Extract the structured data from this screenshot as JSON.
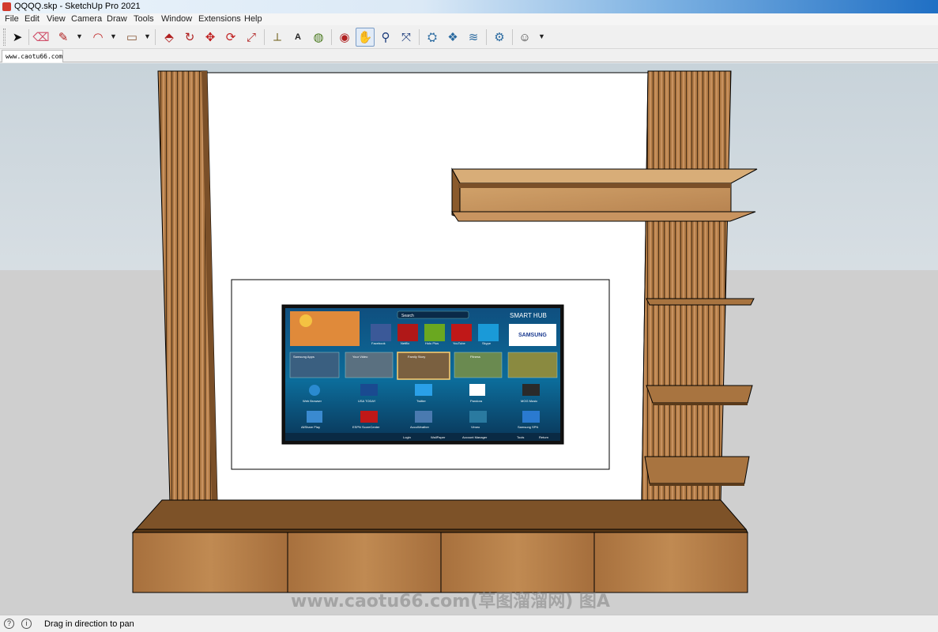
{
  "window": {
    "title": "QQQQ.skp - SketchUp Pro 2021"
  },
  "menu": [
    "File",
    "Edit",
    "View",
    "Camera",
    "Draw",
    "Tools",
    "Window",
    "Extensions",
    "Help"
  ],
  "toolbar": {
    "tools": [
      {
        "name": "select-tool",
        "glyph": "➤"
      },
      {
        "name": "eraser-tool",
        "glyph": "⌫"
      },
      {
        "name": "line-tool",
        "glyph": "✎"
      },
      {
        "name": "arc-tool",
        "glyph": "◠"
      },
      {
        "name": "rectangle-tool",
        "glyph": "▭"
      },
      {
        "name": "push-pull-tool",
        "glyph": "⬘"
      },
      {
        "name": "follow-me-tool",
        "glyph": "↻"
      },
      {
        "name": "move-tool",
        "glyph": "✥"
      },
      {
        "name": "rotate-tool",
        "glyph": "⟳"
      },
      {
        "name": "scale-tool",
        "glyph": "⤢"
      },
      {
        "name": "tape-measure-tool",
        "glyph": "⟂"
      },
      {
        "name": "text-tool",
        "glyph": "A"
      },
      {
        "name": "paint-bucket-tool",
        "glyph": "◍"
      },
      {
        "name": "orbit-tool",
        "glyph": "◉"
      },
      {
        "name": "pan-tool",
        "glyph": "✋"
      },
      {
        "name": "zoom-tool",
        "glyph": "⚲"
      },
      {
        "name": "zoom-extents-tool",
        "glyph": "⤧"
      },
      {
        "name": "warehouse-tool",
        "glyph": "⛭"
      },
      {
        "name": "extension-warehouse-tool",
        "glyph": "❖"
      },
      {
        "name": "layout-tool",
        "glyph": "≋"
      },
      {
        "name": "extension-manager-tool",
        "glyph": "⚙"
      },
      {
        "name": "account-tool",
        "glyph": "☺"
      }
    ],
    "active_tool": "pan-tool"
  },
  "tab": {
    "label": "www.caotu66.com"
  },
  "tv": {
    "hub_title": "SMART HUB",
    "search_label": "Search",
    "brand": "SAMSUNG",
    "apps_row1": [
      "Facebook",
      "Netflix",
      "Hulu Plus",
      "YouTube",
      "Skype"
    ],
    "panels": [
      "Samsung Apps",
      "Your Video",
      "Family Story",
      "Fitness"
    ],
    "apps_row3": [
      "Web Browser",
      "USA TODAY",
      "Twitter",
      "Pandora",
      "MOG Music"
    ],
    "apps_row4": [
      "AllShare Play",
      "ESPN ScoreCenter",
      "AccuWeather",
      "Vimeo",
      "Samsung SPN"
    ],
    "footer": [
      "Login",
      "WallPaper",
      "Account Manager",
      "Tools",
      "Return"
    ]
  },
  "watermark": "www.caotu66.com(草图溜溜网) 图A",
  "status": {
    "message": "Drag in direction to pan"
  },
  "colors": {
    "wood": "#b07a45",
    "wood_dark": "#7a4f28",
    "wall": "#ffffff",
    "tv_bg": "#0b3a5e"
  }
}
